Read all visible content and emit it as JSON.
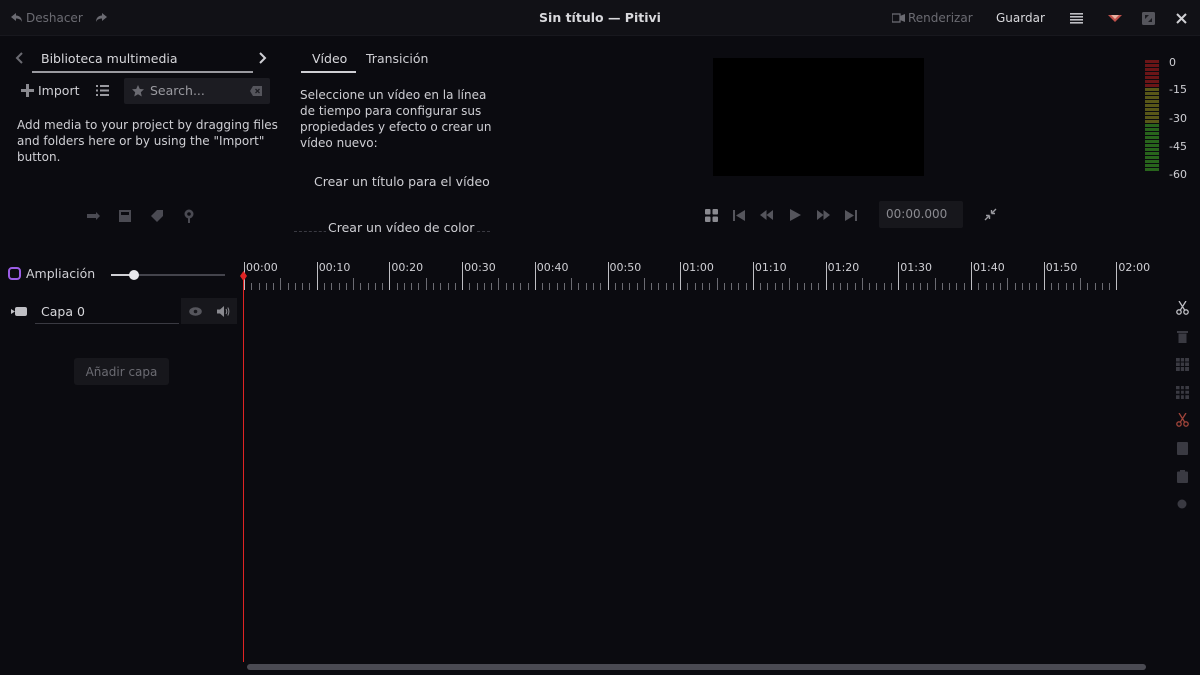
{
  "header": {
    "undo_label": "Deshacer",
    "title": "Sin título — Pitivi",
    "render_label": "Renderizar",
    "save_label": "Guardar"
  },
  "media_library": {
    "title": "Biblioteca multimedia",
    "import_label": "Import",
    "search_placeholder": "Search...",
    "empty_text_line1": "Add media to your project by dragging files",
    "empty_text_line2": "and folders here or by using the \"Import\"",
    "empty_text_line3": "button."
  },
  "clip_panel": {
    "tabs": [
      {
        "label": "Vídeo"
      },
      {
        "label": "Transición"
      }
    ],
    "help_line1": "Seleccione un vídeo en la línea",
    "help_line2": "de tiempo para configurar sus",
    "help_line3": "propiedades y efecto o crear un",
    "help_line4": "vídeo nuevo:",
    "create_title_label": "Crear un título para el vídeo",
    "create_color_label": "Crear un vídeo de color"
  },
  "viewer": {
    "timecode": "00:00.000"
  },
  "audio_meter": {
    "labels": [
      "0",
      "-15",
      "-30",
      "-45",
      "-60"
    ],
    "colors": {
      "high": "#8b1a1a",
      "mid": "#6b6a1a",
      "low": "#2f7a1f"
    }
  },
  "timeline": {
    "zoom_label": "Ampliación",
    "zoom_fraction": 0.2,
    "ruler_labels": [
      "00:00",
      "00:10",
      "00:20",
      "00:30",
      "00:40",
      "00:50",
      "01:00",
      "01:10",
      "01:20",
      "01:30",
      "01:40",
      "01:50",
      "02:00"
    ],
    "layer_name": "Capa 0",
    "add_layer_label": "Añadir capa",
    "playhead_color": "#e02424"
  }
}
